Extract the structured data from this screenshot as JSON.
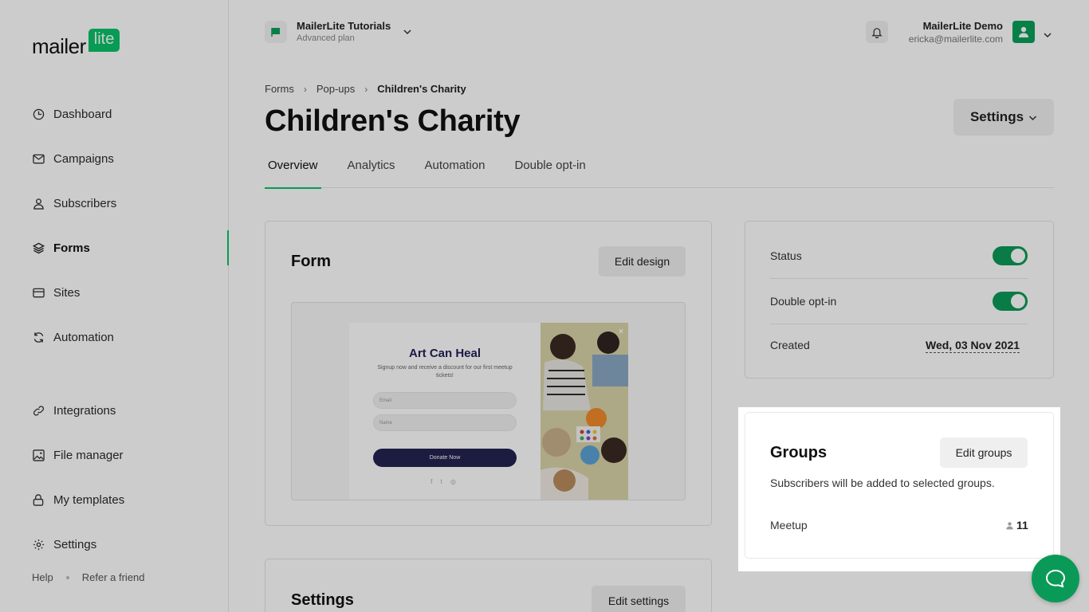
{
  "logo": {
    "text": "mailer",
    "badge": "lite"
  },
  "sidebar": {
    "items": [
      {
        "label": "Dashboard",
        "icon": "clock-icon"
      },
      {
        "label": "Campaigns",
        "icon": "envelope-icon"
      },
      {
        "label": "Subscribers",
        "icon": "user-icon"
      },
      {
        "label": "Forms",
        "icon": "layers-icon",
        "active": true
      },
      {
        "label": "Sites",
        "icon": "browser-icon"
      },
      {
        "label": "Automation",
        "icon": "refresh-icon"
      },
      {
        "label": "Integrations",
        "icon": "link-icon"
      },
      {
        "label": "File manager",
        "icon": "image-icon"
      },
      {
        "label": "My templates",
        "icon": "lock-icon"
      },
      {
        "label": "Settings",
        "icon": "gear-icon"
      }
    ],
    "footer": {
      "help": "Help",
      "refer": "Refer a friend"
    }
  },
  "account": {
    "name": "MailerLite Tutorials",
    "plan": "Advanced plan"
  },
  "user": {
    "name": "MailerLite Demo",
    "email": "ericka@mailerlite.com"
  },
  "breadcrumb": {
    "items": [
      "Forms",
      "Pop-ups"
    ],
    "current": "Children's Charity"
  },
  "page": {
    "title": "Children's Charity",
    "settings_label": "Settings"
  },
  "tabs": [
    "Overview",
    "Analytics",
    "Automation",
    "Double opt-in"
  ],
  "form_card": {
    "title": "Form",
    "edit_label": "Edit design",
    "preview": {
      "title": "Art Can Heal",
      "subtitle": "Signup now and receive a discount for our first meetup tickets!",
      "email_placeholder": "Email",
      "name_placeholder": "Name",
      "button": "Donate Now",
      "social": "f t ◎",
      "close": "×"
    }
  },
  "status_card": {
    "status_label": "Status",
    "double_optin_label": "Double opt-in",
    "created_label": "Created",
    "created_value": "Wed, 03 Nov 2021",
    "status_on": true,
    "double_optin_on": true
  },
  "groups_card": {
    "title": "Groups",
    "edit_label": "Edit groups",
    "subtitle": "Subscribers will be added to selected groups.",
    "groups": [
      {
        "name": "Meetup",
        "count": "11"
      }
    ]
  },
  "settings_card": {
    "title": "Settings",
    "edit_label": "Edit settings"
  },
  "colors": {
    "brand": "#09c269",
    "toggle_on": "#0a9a58",
    "popup_button": "#242250"
  }
}
